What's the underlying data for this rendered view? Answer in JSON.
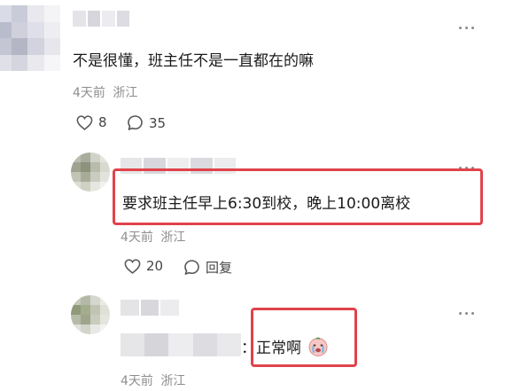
{
  "comments": [
    {
      "text": "不是很懂，班主任不是一直都在的嘛",
      "time": "4天前",
      "location": "浙江",
      "likes": "8",
      "replies": "35"
    },
    {
      "text": "要求班主任早上6:30到校，晚上10:00离校",
      "time": "4天前",
      "location": "浙江",
      "likes": "20",
      "reply_label": "回复"
    },
    {
      "text_suffix": "：正常啊",
      "time": "4天前",
      "location": "浙江"
    }
  ],
  "colors": {
    "highlight": "#e0434b",
    "meta": "#8e8e8e"
  }
}
